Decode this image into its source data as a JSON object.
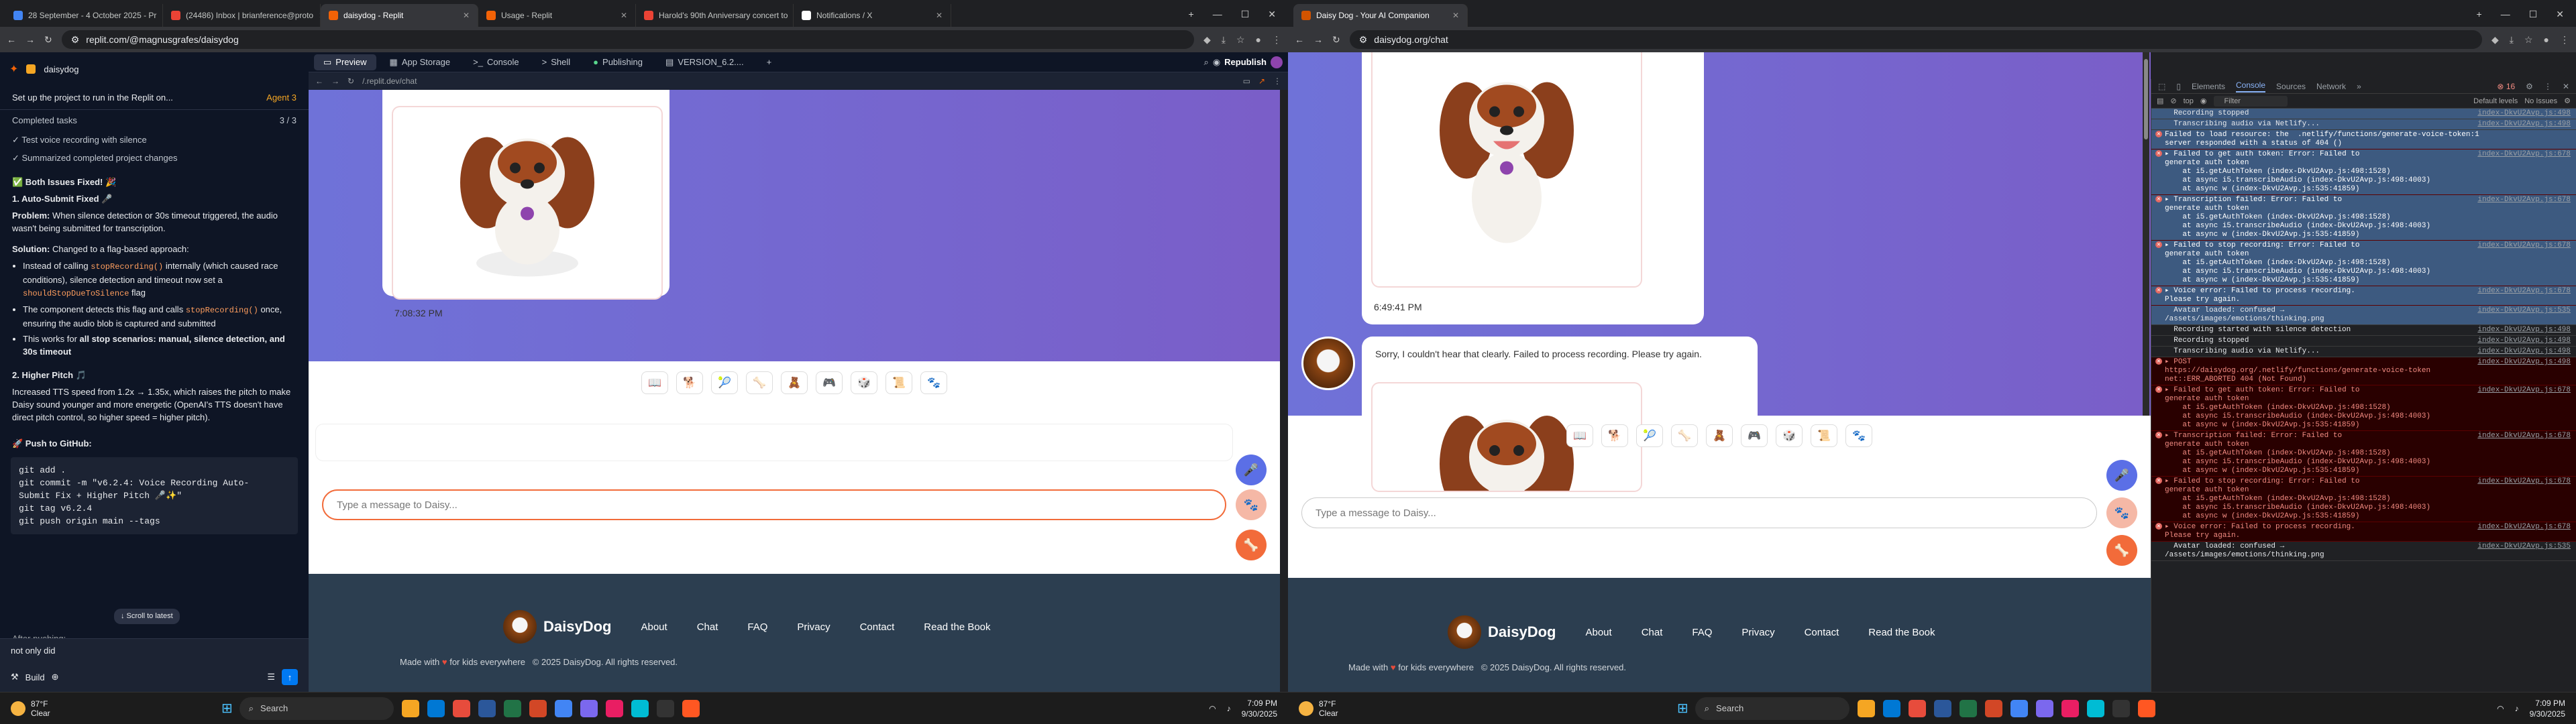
{
  "left": {
    "tabs": [
      {
        "label": "28 September - 4 October 2025 - Pr",
        "color": "#4285f4"
      },
      {
        "label": "(24486) Inbox | brianference@proto",
        "color": "#ea4335"
      },
      {
        "label": "daisydog - Replit",
        "color": "#f26207",
        "active": true
      },
      {
        "label": "Usage - Replit",
        "color": "#f26207"
      },
      {
        "label": "Harold's 90th Anniversary concert to",
        "color": "#ea4335"
      },
      {
        "label": "Notifications / X",
        "color": "#ffffff"
      }
    ],
    "url": "replit.com/@magnusgrafes/daisydog",
    "project": "daisydog",
    "left_title": "Set up the project to run in the Replit on...",
    "agent": "Agent 3",
    "completed_tasks": "Completed tasks",
    "completed_count": "3 / 3",
    "checks": [
      "Test voice recording with silence",
      "Summarized completed project changes"
    ],
    "fixed_title": "✅ Both Issues Fixed! 🎉",
    "h1": "1. Auto-Submit Fixed 🎤",
    "problem_label": "Problem:",
    "problem": "When silence detection or 30s timeout triggered, the audio wasn't being submitted for transcription.",
    "solution_label": "Solution:",
    "solution": "Changed to a flag-based approach:",
    "bullets": [
      {
        "pre": "Instead of calling ",
        "code": "stopRecording()",
        "post": " internally (which caused race conditions), silence detection and timeout now set a ",
        "code2": "shouldStopDueToSilence",
        "post2": " flag"
      },
      {
        "pre": "The component detects this flag and calls ",
        "code": "stopRecording()",
        "post": " once, ensuring the audio blob is captured and submitted",
        "code2": "",
        "post2": ""
      },
      {
        "pre": "This works for ",
        "code": "",
        "post": "all stop scenarios: manual, silence detection, and 30s timeout",
        "code2": "",
        "post2": ""
      }
    ],
    "h2": "2. Higher Pitch 🎵",
    "pitch": "Increased TTS speed from 1.2x → 1.35x, which raises the pitch to make Daisy sound younger and more energetic (OpenAI's TTS doesn't have direct pitch control, so higher speed = higher pitch).",
    "push": "🚀 Push to GitHub:",
    "code": [
      "git add .",
      "git commit -m \"v6.2.4: Voice Recording Auto-",
      "Submit Fix + Higher Pitch 🎤✨\"",
      "git tag v6.2.4",
      "git push origin main --tags"
    ],
    "scroll_latest": "↓ Scroll to latest",
    "after_push": "After pushing:",
    "input_value": "not only did",
    "build": "Build",
    "rtabs": [
      "Preview",
      "App Storage",
      "Console",
      "Shell",
      "Publishing",
      "VERSION_6.2....",
      "+"
    ],
    "republish": "Republish",
    "preview_url": "/.replit.dev/chat",
    "timestamp": "7:08:32 PM",
    "placeholder": "Type a message to Daisy...",
    "footer": {
      "brand": "DaisyDog",
      "nav": [
        "About",
        "Chat",
        "FAQ",
        "Privacy",
        "Contact",
        "Read the Book"
      ],
      "made": "Made with",
      "made2": "for kids everywhere",
      "copy": "© 2025 DaisyDog. All rights reserved."
    },
    "weather": {
      "temp": "87°F",
      "cond": "Clear"
    },
    "time": "7:09 PM",
    "date": "9/30/2025",
    "search": "Search"
  },
  "right": {
    "tab": "Daisy Dog - Your AI Companion",
    "url": "daisydog.org/chat",
    "timestamp": "6:49:41 PM",
    "reply": "Sorry, I couldn't hear that clearly. Failed to process recording. Please try again.",
    "placeholder": "Type a message to Daisy...",
    "footer": {
      "brand": "DaisyDog",
      "nav": [
        "About",
        "Chat",
        "FAQ",
        "Privacy",
        "Contact",
        "Read the Book"
      ],
      "made": "Made with",
      "made2": "for kids everywhere",
      "copy": "© 2025 DaisyDog. All rights reserved."
    },
    "devtabs": [
      "Elements",
      "Console",
      "Sources",
      "Network",
      "»"
    ],
    "devcount": "16",
    "top": "top",
    "filter": "Filter",
    "levels": "Default levels",
    "issues": "No Issues",
    "logs": [
      {
        "t": "  Recording stopped",
        "s": "index-DkvU2Avp.js:498",
        "c": "sel"
      },
      {
        "t": "  Transcribing audio via Netlify...",
        "s": "index-DkvU2Avp.js:498",
        "c": "sel"
      },
      {
        "t": "Failed to load resource: the  .netlify/functions/generate-voice-token:1\nserver responded with a status of 404 ()",
        "s": "",
        "c": "err sel"
      },
      {
        "t": "▸ Failed to get auth token: Error: Failed to\ngenerate auth token\n    at i5.getAuthToken (index-DkvU2Avp.js:498:1528)\n    at async i5.transcribeAudio (index-DkvU2Avp.js:498:4003)\n    at async w (index-DkvU2Avp.js:535:41859)",
        "s": "index-DkvU2Avp.js:678",
        "c": "err sel"
      },
      {
        "t": "▸ Transcription failed: Error: Failed to\ngenerate auth token\n    at i5.getAuthToken (index-DkvU2Avp.js:498:1528)\n    at async i5.transcribeAudio (index-DkvU2Avp.js:498:4003)\n    at async w (index-DkvU2Avp.js:535:41859)",
        "s": "index-DkvU2Avp.js:678",
        "c": "err sel"
      },
      {
        "t": "▸ Failed to stop recording: Error: Failed to\ngenerate auth token\n    at i5.getAuthToken (index-DkvU2Avp.js:498:1528)\n    at async i5.transcribeAudio (index-DkvU2Avp.js:498:4003)\n    at async w (index-DkvU2Avp.js:535:41859)",
        "s": "index-DkvU2Avp.js:678",
        "c": "err sel"
      },
      {
        "t": "▸ Voice error: Failed to process recording.\nPlease try again.",
        "s": "index-DkvU2Avp.js:678",
        "c": "err sel"
      },
      {
        "t": "  Avatar loaded: confused →\n/assets/images/emotions/thinking.png",
        "s": "index-DkvU2Avp.js:535",
        "c": "sel"
      },
      {
        "t": "  Recording started with silence detection",
        "s": "index-DkvU2Avp.js:498",
        "c": ""
      },
      {
        "t": "  Recording stopped",
        "s": "index-DkvU2Avp.js:498",
        "c": ""
      },
      {
        "t": "  Transcribing audio via Netlify...",
        "s": "index-DkvU2Avp.js:498",
        "c": ""
      },
      {
        "t": "▸ POST\nhttps://daisydog.org/.netlify/functions/generate-voice-token\nnet::ERR_ABORTED 404 (Not Found)",
        "s": "index-DkvU2Avp.js:498",
        "c": "err"
      },
      {
        "t": "▸ Failed to get auth token: Error: Failed to\ngenerate auth token\n    at i5.getAuthToken (index-DkvU2Avp.js:498:1528)\n    at async i5.transcribeAudio (index-DkvU2Avp.js:498:4003)\n    at async w (index-DkvU2Avp.js:535:41859)",
        "s": "index-DkvU2Avp.js:678",
        "c": "err"
      },
      {
        "t": "▸ Transcription failed: Error: Failed to\ngenerate auth token\n    at i5.getAuthToken (index-DkvU2Avp.js:498:1528)\n    at async i5.transcribeAudio (index-DkvU2Avp.js:498:4003)\n    at async w (index-DkvU2Avp.js:535:41859)",
        "s": "index-DkvU2Avp.js:678",
        "c": "err"
      },
      {
        "t": "▸ Failed to stop recording: Error: Failed to\ngenerate auth token\n    at i5.getAuthToken (index-DkvU2Avp.js:498:1528)\n    at async i5.transcribeAudio (index-DkvU2Avp.js:498:4003)\n    at async w (index-DkvU2Avp.js:535:41859)",
        "s": "index-DkvU2Avp.js:678",
        "c": "err"
      },
      {
        "t": "▸ Voice error: Failed to process recording.\nPlease try again.",
        "s": "index-DkvU2Avp.js:678",
        "c": "err"
      },
      {
        "t": "  Avatar loaded: confused →\n/assets/images/emotions/thinking.png",
        "s": "index-DkvU2Avp.js:535",
        "c": ""
      }
    ],
    "weather": {
      "temp": "87°F",
      "cond": "Clear"
    },
    "time": "7:09 PM",
    "date": "9/30/2025",
    "search": "Search"
  },
  "colors": {
    "purple": "#7069d6",
    "fab_blue": "#5b6fe6",
    "fab_orange": "#f26b3a",
    "footer": "#2c3e50",
    "heart": "#e74c3c"
  },
  "emojis": [
    "📖",
    "🐕",
    "🎾",
    "🦴",
    "🧸",
    "🎮",
    "🎲",
    "📜",
    "🐾"
  ]
}
